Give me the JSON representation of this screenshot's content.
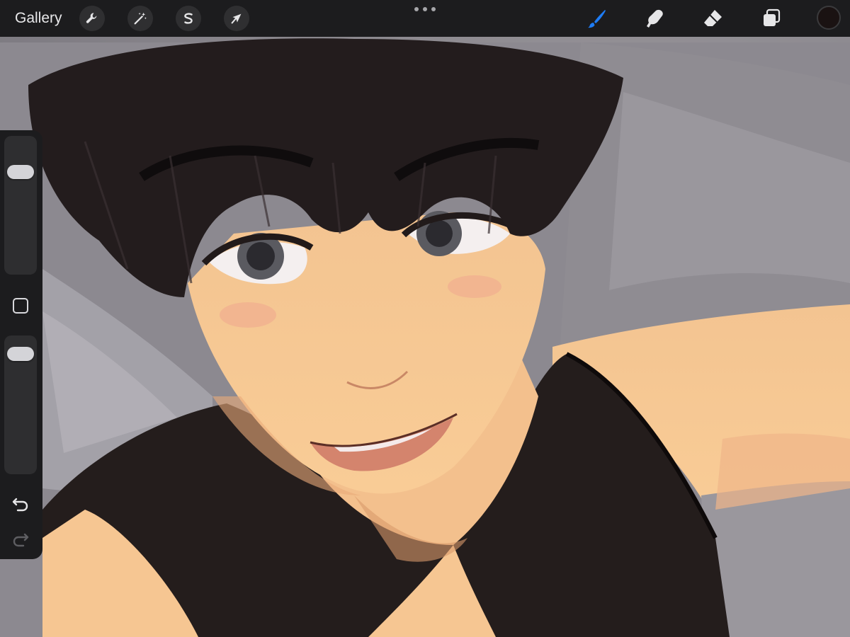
{
  "app": {
    "gallery_label": "Gallery"
  },
  "toolbar": {
    "left_tools": [
      {
        "name": "actions",
        "icon": "wrench-icon"
      },
      {
        "name": "adjustments",
        "icon": "magic-wand-icon"
      },
      {
        "name": "selection",
        "icon": "selection-s-icon"
      },
      {
        "name": "transform",
        "icon": "arrow-cursor-icon"
      }
    ],
    "more_icon": "more-dots-icon",
    "right_tools": [
      {
        "name": "brush",
        "icon": "brush-icon",
        "active": true
      },
      {
        "name": "smudge",
        "icon": "smudge-finger-icon",
        "active": false
      },
      {
        "name": "eraser",
        "icon": "eraser-icon",
        "active": false
      },
      {
        "name": "layers",
        "icon": "layers-icon",
        "active": false
      }
    ],
    "current_color": "#1a1212",
    "accent_color": "#1e7cf5"
  },
  "sidebar": {
    "brush_size_level": 0.78,
    "brush_opacity_level": 0.93,
    "modify_icon": "square-modify-icon",
    "undo_icon": "undo-icon",
    "redo_icon": "redo-icon"
  }
}
